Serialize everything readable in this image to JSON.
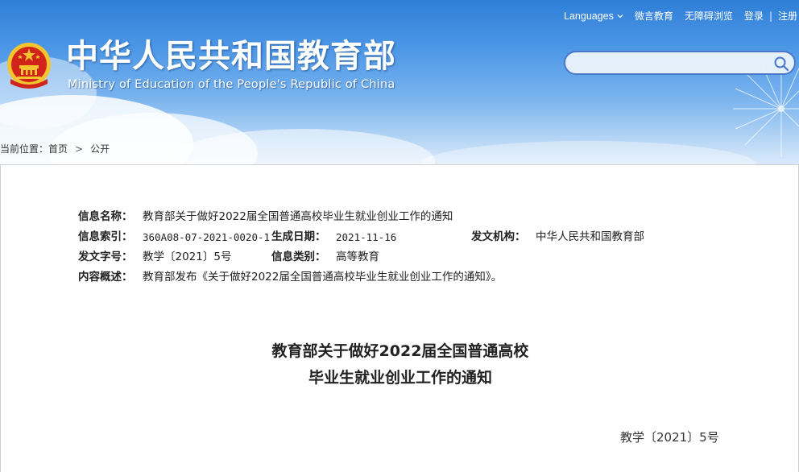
{
  "header": {
    "title": "中华人民共和国教育部",
    "subtitle": "Ministry of Education of the People's Republic of China",
    "emblem_icon": "national-emblem-icon",
    "top_links": {
      "languages": "Languages",
      "weibo": "微言教育",
      "accessibility": "无障碍浏览",
      "login": "登录",
      "separator": "|",
      "register": "注册"
    },
    "search": {
      "placeholder": ""
    }
  },
  "breadcrumb": {
    "prefix": "当前位置：",
    "home": "首页",
    "arrow": ">",
    "current": "公开"
  },
  "info": {
    "name_label": "信息名称：",
    "name_value": "教育部关于做好2022届全国普通高校毕业生就业创业工作的通知",
    "index_label": "信息索引：",
    "index_value": "360A08-07-2021-0020-1",
    "date_label": "生成日期：",
    "date_value": "2021-11-16",
    "org_label": "发文机构：",
    "org_value": "中华人民共和国教育部",
    "docno_label": "发文字号：",
    "docno_value": "教学〔2021〕5号",
    "category_label": "信息类别：",
    "category_value": "高等教育",
    "summary_label": "内容概述：",
    "summary_value": "教育部发布《关于做好2022届全国普通高校毕业生就业创业工作的通知》。"
  },
  "document": {
    "title_line1": "教育部关于做好2022届全国普通高校",
    "title_line2": "毕业生就业创业工作的通知",
    "number": "教学〔2021〕5号"
  },
  "colors": {
    "header_top": "#2f7fd8",
    "header_bottom": "#dbeafb",
    "search_border": "#4b78c8",
    "emblem_red": "#d0241b",
    "emblem_gold": "#f4c430"
  }
}
